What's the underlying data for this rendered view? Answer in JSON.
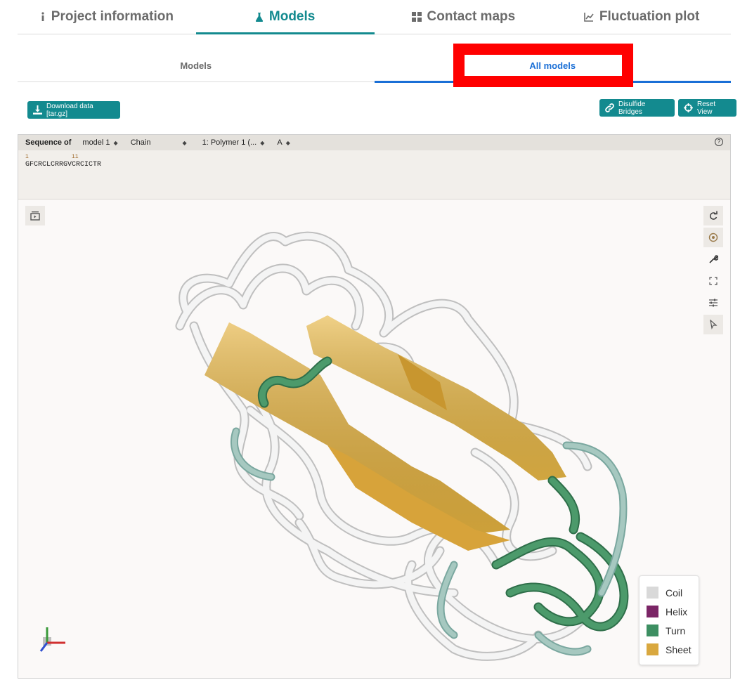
{
  "tabs": [
    {
      "label": "Project information",
      "icon": "info-icon",
      "active": false
    },
    {
      "label": "Models",
      "icon": "flask-icon",
      "active": true
    },
    {
      "label": "Contact maps",
      "icon": "grid-icon",
      "active": false
    },
    {
      "label": "Fluctuation plot",
      "icon": "line-chart-icon",
      "active": false
    }
  ],
  "subtabs": [
    {
      "label": "Models",
      "active": false
    },
    {
      "label": "All models",
      "active": true
    }
  ],
  "buttons": {
    "download": "Download data [tar.gz]",
    "disulfide": "Disulfide Bridges",
    "reset": "Reset View"
  },
  "sequence": {
    "label": "Sequence of",
    "model": "model 1",
    "chain": "Chain",
    "polymer": "1: Polymer 1 (...",
    "chain_id": "A",
    "num1": "1",
    "num2": "11",
    "text": "GFCRCLCRRGVCRCICTR"
  },
  "legend": [
    {
      "label": "Coil",
      "color": "#d9d9d9"
    },
    {
      "label": "Helix",
      "color": "#7b2566"
    },
    {
      "label": "Turn",
      "color": "#3d8f62"
    },
    {
      "label": "Sheet",
      "color": "#d9a83f"
    }
  ],
  "colors": {
    "accent": "#138a8f",
    "active_subtab": "#1a6fd6",
    "highlight": "#ff0000"
  }
}
